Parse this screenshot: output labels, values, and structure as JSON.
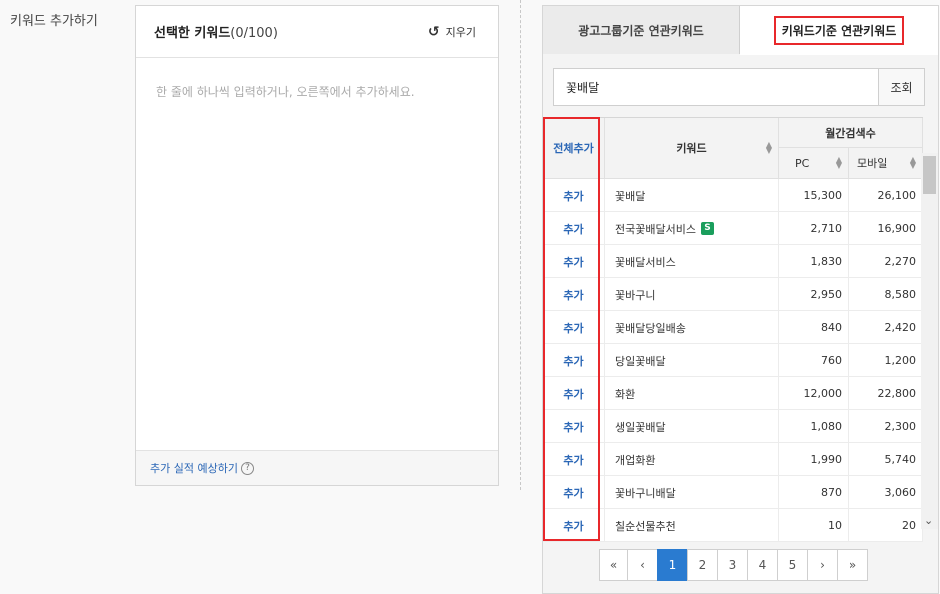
{
  "section_label": "키워드 추가하기",
  "selected_panel": {
    "title": "선택한 키워드",
    "count": "(0/100)",
    "clear_label": "지우기",
    "placeholder": "한 줄에 하나씩 입력하거나, 오른쪽에서 추가하세요.",
    "footer_link": "추가 실적 예상하기",
    "help_glyph": "?"
  },
  "tabs": [
    {
      "label": "광고그룹기준 연관키워드",
      "active": false
    },
    {
      "label": "키워드기준 연관키워드",
      "active": true
    }
  ],
  "search": {
    "value": "꽃배달",
    "button_label": "조회"
  },
  "table": {
    "headers": {
      "add_all": "전체추가",
      "keyword": "키워드",
      "monthly": "월간검색수",
      "pc": "PC",
      "mobile": "모바일"
    },
    "add_label": "추가",
    "rows": [
      {
        "keyword": "꽃배달",
        "pc": "15,300",
        "mobile": "26,100",
        "badge": ""
      },
      {
        "keyword": "전국꽃배달서비스",
        "pc": "2,710",
        "mobile": "16,900",
        "badge": "S"
      },
      {
        "keyword": "꽃배달서비스",
        "pc": "1,830",
        "mobile": "2,270",
        "badge": ""
      },
      {
        "keyword": "꽃바구니",
        "pc": "2,950",
        "mobile": "8,580",
        "badge": ""
      },
      {
        "keyword": "꽃배달당일배송",
        "pc": "840",
        "mobile": "2,420",
        "badge": ""
      },
      {
        "keyword": "당일꽃배달",
        "pc": "760",
        "mobile": "1,200",
        "badge": ""
      },
      {
        "keyword": "화환",
        "pc": "12,000",
        "mobile": "22,800",
        "badge": ""
      },
      {
        "keyword": "생일꽃배달",
        "pc": "1,080",
        "mobile": "2,300",
        "badge": ""
      },
      {
        "keyword": "개업화환",
        "pc": "1,990",
        "mobile": "5,740",
        "badge": ""
      },
      {
        "keyword": "꽃바구니배달",
        "pc": "870",
        "mobile": "3,060",
        "badge": ""
      },
      {
        "keyword": "칠순선물추천",
        "pc": "10",
        "mobile": "20",
        "badge": ""
      }
    ]
  },
  "pagination": {
    "first": "«",
    "prev": "‹",
    "pages": [
      "1",
      "2",
      "3",
      "4",
      "5"
    ],
    "active_page": "1",
    "next": "›",
    "last": "»"
  },
  "colors": {
    "accent": "#2a7bd0",
    "highlight": "#e8282b",
    "link": "#2b67b6",
    "badge": "#1a9e5c"
  }
}
